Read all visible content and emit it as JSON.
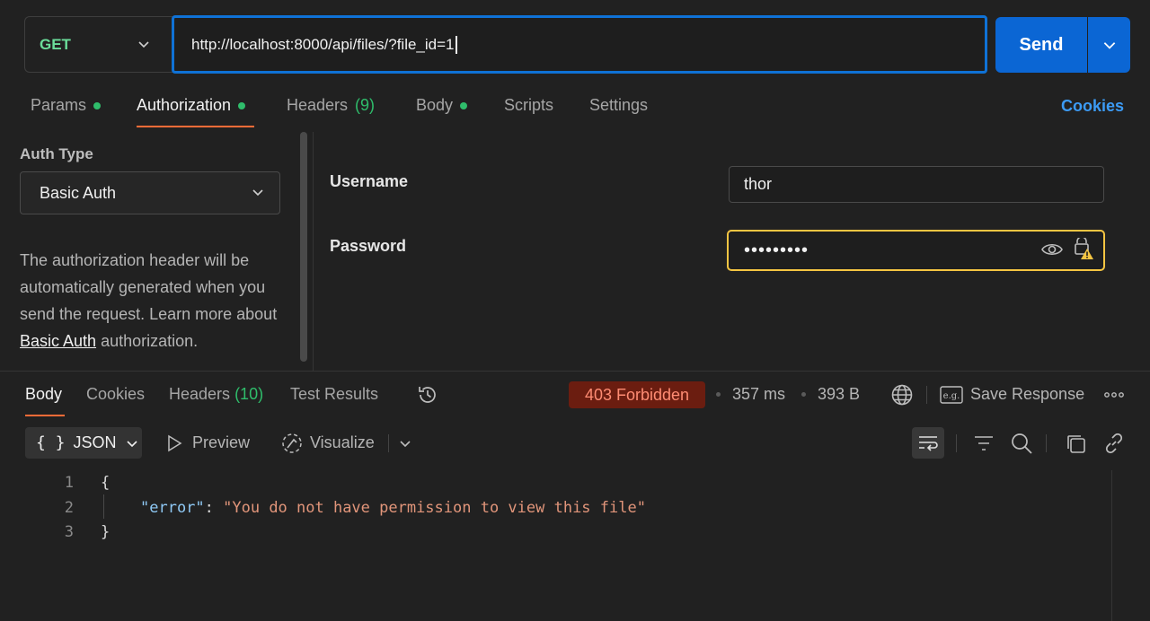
{
  "request": {
    "method": "GET",
    "url": "http://localhost:8000/api/files/?file_id=1",
    "send_label": "Send"
  },
  "request_tabs": [
    {
      "label": "Params",
      "dot": true
    },
    {
      "label": "Authorization",
      "dot": true,
      "active": true
    },
    {
      "label": "Headers",
      "count": "(9)"
    },
    {
      "label": "Body",
      "dot": true
    },
    {
      "label": "Scripts"
    },
    {
      "label": "Settings"
    }
  ],
  "cookies_link": "Cookies",
  "auth": {
    "type_label": "Auth Type",
    "type_value": "Basic Auth",
    "desc_prefix": "The authorization header will be automatically generated when you send the request. Learn more about ",
    "desc_link": "Basic Auth",
    "desc_suffix": " authorization.",
    "username_label": "Username",
    "username_value": "thor",
    "password_label": "Password",
    "password_masked": "•••••••••"
  },
  "response_tabs": [
    {
      "label": "Body",
      "active": true
    },
    {
      "label": "Cookies"
    },
    {
      "label": "Headers",
      "count": "(10)"
    },
    {
      "label": "Test Results"
    }
  ],
  "response_meta": {
    "status": "403 Forbidden",
    "time": "357 ms",
    "size": "393 B",
    "save_label": "Save Response"
  },
  "body_toolbar": {
    "format": "JSON",
    "preview": "Preview",
    "visualize": "Visualize"
  },
  "code_lines": {
    "l1": "1",
    "l2": "2",
    "l3": "3",
    "open": "{",
    "key": "\"error\"",
    "colon": ": ",
    "value": "\"You do not have permission to view this file\"",
    "close": "}"
  },
  "colors": {
    "accent": "#0b66d4",
    "tab_underline": "#ff6c37",
    "status_bg": "#6b1d10",
    "status_text": "#ff8c73",
    "method_green": "#6bdd9a",
    "warning": "#f5c542"
  }
}
